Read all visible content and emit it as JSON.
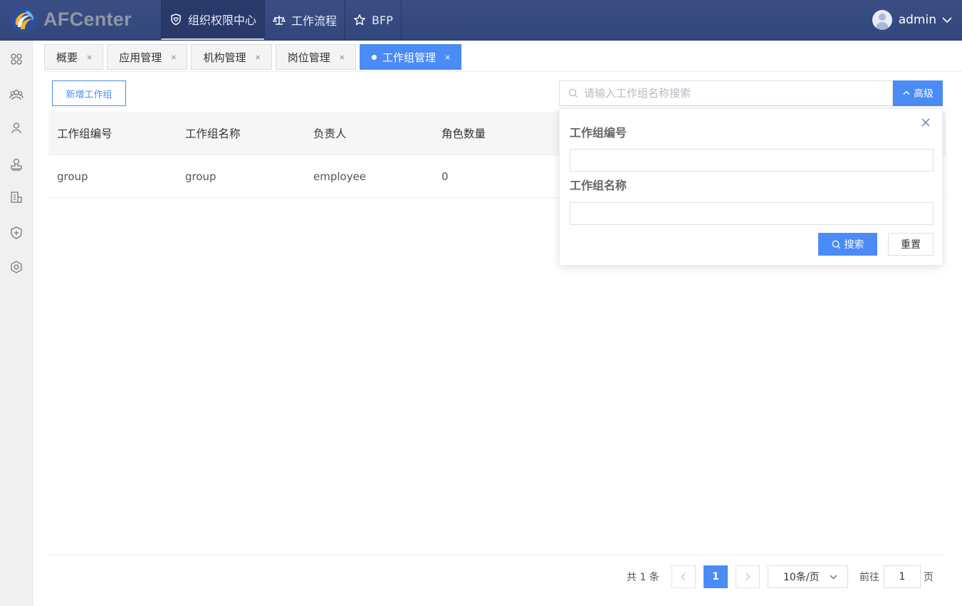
{
  "app": {
    "title": "AFCenter"
  },
  "nav": [
    {
      "label": "组织权限中心",
      "icon": "heart-shield-icon",
      "active": true
    },
    {
      "label": "工作流程",
      "icon": "scale-icon",
      "active": false
    },
    {
      "label": "BFP",
      "icon": "star-icon",
      "active": false
    }
  ],
  "user": {
    "name": "admin"
  },
  "sidebar": {
    "icons": [
      "grid-icon",
      "group-icon",
      "user-icon",
      "stamp-icon",
      "document-icon",
      "shield-plus-icon",
      "gear-icon"
    ]
  },
  "tabs": [
    {
      "label": "概要",
      "close": "×"
    },
    {
      "label": "应用管理",
      "close": "×"
    },
    {
      "label": "机构管理",
      "close": "×"
    },
    {
      "label": "岗位管理",
      "close": "×"
    },
    {
      "label": "工作组管理",
      "close": "×",
      "active": true
    }
  ],
  "toolbar": {
    "add_label": "新增工作组",
    "search_placeholder": "请输入工作组名称搜索",
    "search_value": "",
    "advanced_label": "高级"
  },
  "table": {
    "headers": [
      "工作组编号",
      "工作组名称",
      "负责人",
      "角色数量"
    ],
    "rows": [
      {
        "code": "group",
        "name": "group",
        "owner": "employee",
        "roles": "0"
      }
    ]
  },
  "advanced": {
    "code_label": "工作组编号",
    "code_value": "",
    "name_label": "工作组名称",
    "name_value": "",
    "search_label": "搜索",
    "reset_label": "重置"
  },
  "pagination": {
    "total_text": "共 1 条",
    "current_page": "1",
    "page_size": "10条/页",
    "goto_label": "前往",
    "goto_value": "1",
    "page_suffix": "页"
  },
  "colors": {
    "accent": "#4b8bf5",
    "topbar": "#34497f"
  }
}
